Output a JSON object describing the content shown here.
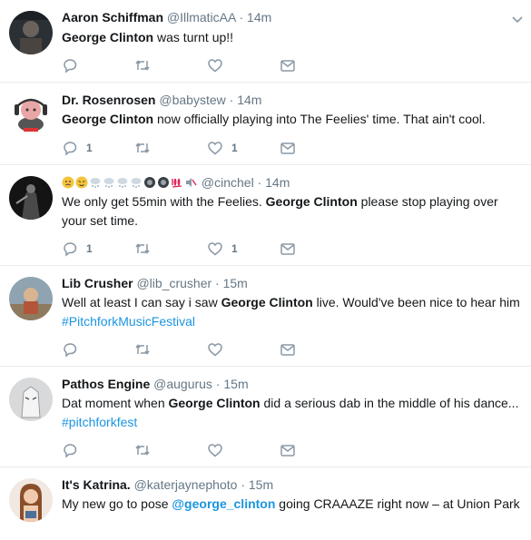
{
  "tweets": [
    {
      "fullname": "Aaron Schiffman",
      "handle": "@IllmaticAA",
      "time": "14m",
      "text_parts": [
        "George Clinton",
        " was turnt up!!"
      ],
      "reply_count": "",
      "like_count": ""
    },
    {
      "fullname": "Dr. Rosenrosen",
      "handle": "@babystew",
      "time": "14m",
      "text_parts": [
        "George Clinton",
        " now officially playing into The Feelies' time. That ain't cool."
      ],
      "reply_count": "1",
      "like_count": "1"
    },
    {
      "fullname": "",
      "handle": "@cinchel",
      "time": "14m",
      "text_parts": [
        "We only get 55min with the Feelies. ",
        "George Clinton",
        " please stop playing over your set time."
      ],
      "reply_count": "1",
      "like_count": "1"
    },
    {
      "fullname": "Lib Crusher",
      "handle": "@lib_crusher",
      "time": "15m",
      "text_parts": [
        "Well at least I can say i saw ",
        "George Clinton",
        " live. Would've been nice to hear him "
      ],
      "hashtag": "#PitchforkMusicFestival",
      "reply_count": "",
      "like_count": ""
    },
    {
      "fullname": "Pathos Engine",
      "handle": "@augurus",
      "time": "15m",
      "text_parts": [
        "Dat moment when ",
        "George Clinton",
        " did a serious dab in the middle of his dance..."
      ],
      "hashtag": "#pitchforkfest",
      "reply_count": "",
      "like_count": ""
    },
    {
      "fullname": "It's Katrina.",
      "handle": "@katerjaynephoto",
      "time": "15m",
      "text_parts": [
        "My new go to pose ",
        "@george_clinton",
        " going CRAAAZE right now  – at Union Park"
      ],
      "reply_count": "",
      "like_count": ""
    }
  ],
  "separator": "·",
  "icons": {
    "reply": "reply-icon",
    "retweet": "retweet-icon",
    "like": "heart-icon",
    "dm": "envelope-icon",
    "more": "chevron-down-icon"
  },
  "colors": {
    "text": "#14171a",
    "secondary": "#657786",
    "link": "#1b95e0",
    "border": "#e6ecf0",
    "icon": "#8a98a5"
  }
}
